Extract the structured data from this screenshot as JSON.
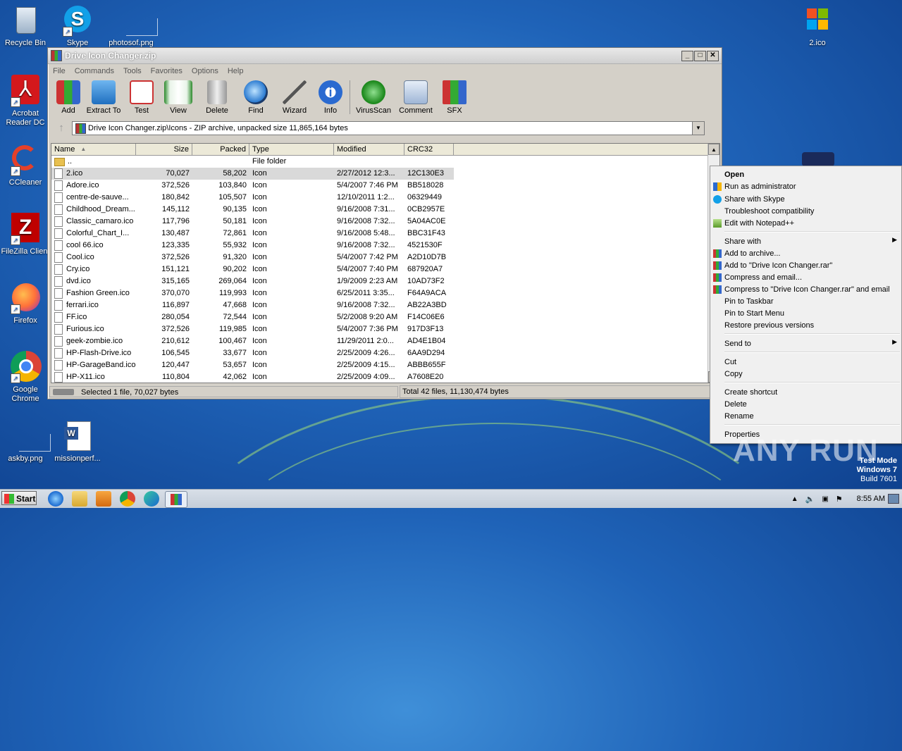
{
  "desktop": {
    "icons": [
      {
        "label": "Recycle Bin",
        "icon": "recycle-bin-icon"
      },
      {
        "label": "Skype",
        "icon": "skype-icon"
      },
      {
        "label": "photosof.png",
        "icon": "image-file-icon"
      },
      {
        "label": "Acrobat Reader DC",
        "icon": "acrobat-icon"
      },
      {
        "label": "CCleaner",
        "icon": "ccleaner-icon"
      },
      {
        "label": "FileZilla Client",
        "icon": "filezilla-icon"
      },
      {
        "label": "Firefox",
        "icon": "firefox-icon"
      },
      {
        "label": "Google Chrome",
        "icon": "chrome-icon"
      },
      {
        "label": "askby.png",
        "icon": "image-file-icon"
      },
      {
        "label": "missionperf...",
        "icon": "word-doc-icon"
      },
      {
        "label": "2.ico",
        "icon": "windows-logo-icon"
      }
    ],
    "testmode": [
      "Test Mode",
      "Windows 7",
      "Build 7601"
    ],
    "watermark": "ANY RUN"
  },
  "window": {
    "title": "Drive Icon Changer.zip",
    "menu": [
      "File",
      "Commands",
      "Tools",
      "Favorites",
      "Options",
      "Help"
    ],
    "toolbar": [
      {
        "label": "Add",
        "icon": "add-archive-icon"
      },
      {
        "label": "Extract To",
        "icon": "extract-folder-icon"
      },
      {
        "label": "Test",
        "icon": "test-checklist-icon"
      },
      {
        "label": "View",
        "icon": "view-book-icon"
      },
      {
        "label": "Delete",
        "icon": "trash-icon"
      },
      {
        "label": "Find",
        "icon": "magnifier-icon"
      },
      {
        "label": "Wizard",
        "icon": "wand-icon"
      },
      {
        "label": "Info",
        "icon": "info-icon"
      },
      {
        "label": "VirusScan",
        "icon": "virus-scan-icon"
      },
      {
        "label": "Comment",
        "icon": "comment-icon"
      },
      {
        "label": "SFX",
        "icon": "sfx-box-icon"
      }
    ],
    "address": "Drive Icon Changer.zip\\Icons - ZIP archive, unpacked size 11,865,164 bytes",
    "columns": [
      "Name",
      "Size",
      "Packed",
      "Type",
      "Modified",
      "CRC32"
    ],
    "files": [
      {
        "name": "..",
        "size": "",
        "packed": "",
        "type": "File folder",
        "modified": "",
        "crc": ""
      },
      {
        "name": "2.ico",
        "size": "70,027",
        "packed": "58,202",
        "type": "Icon",
        "modified": "2/27/2012 12:3...",
        "crc": "12C130E3"
      },
      {
        "name": "Adore.ico",
        "size": "372,526",
        "packed": "103,840",
        "type": "Icon",
        "modified": "5/4/2007 7:46 PM",
        "crc": "BB518028"
      },
      {
        "name": "centre-de-sauve...",
        "size": "180,842",
        "packed": "105,507",
        "type": "Icon",
        "modified": "12/10/2011 1:2...",
        "crc": "06329449"
      },
      {
        "name": "Childhood_Dream...",
        "size": "145,112",
        "packed": "90,135",
        "type": "Icon",
        "modified": "9/16/2008 7:31...",
        "crc": "0CB2957E"
      },
      {
        "name": "Classic_camaro.ico",
        "size": "117,796",
        "packed": "50,181",
        "type": "Icon",
        "modified": "9/16/2008 7:32...",
        "crc": "5A04AC0E"
      },
      {
        "name": "Colorful_Chart_I...",
        "size": "130,487",
        "packed": "72,861",
        "type": "Icon",
        "modified": "9/16/2008 5:48...",
        "crc": "BBC31F43"
      },
      {
        "name": "cool 66.ico",
        "size": "123,335",
        "packed": "55,932",
        "type": "Icon",
        "modified": "9/16/2008 7:32...",
        "crc": "4521530F"
      },
      {
        "name": "Cool.ico",
        "size": "372,526",
        "packed": "91,320",
        "type": "Icon",
        "modified": "5/4/2007 7:42 PM",
        "crc": "A2D10D7B"
      },
      {
        "name": "Cry.ico",
        "size": "151,121",
        "packed": "90,202",
        "type": "Icon",
        "modified": "5/4/2007 7:40 PM",
        "crc": "687920A7"
      },
      {
        "name": "dvd.ico",
        "size": "315,165",
        "packed": "269,064",
        "type": "Icon",
        "modified": "1/9/2009 2:23 AM",
        "crc": "10AD73F2"
      },
      {
        "name": "Fashion Green.ico",
        "size": "370,070",
        "packed": "119,993",
        "type": "Icon",
        "modified": "6/25/2011 3:35...",
        "crc": "F64A9ACA"
      },
      {
        "name": "ferrari.ico",
        "size": "116,897",
        "packed": "47,668",
        "type": "Icon",
        "modified": "9/16/2008 7:32...",
        "crc": "AB22A3BD"
      },
      {
        "name": "FF.ico",
        "size": "280,054",
        "packed": "72,544",
        "type": "Icon",
        "modified": "5/2/2008 9:20 AM",
        "crc": "F14C06E6"
      },
      {
        "name": "Furious.ico",
        "size": "372,526",
        "packed": "119,985",
        "type": "Icon",
        "modified": "5/4/2007 7:36 PM",
        "crc": "917D3F13"
      },
      {
        "name": "geek-zombie.ico",
        "size": "210,612",
        "packed": "100,467",
        "type": "Icon",
        "modified": "11/29/2011 2:0...",
        "crc": "AD4E1B04"
      },
      {
        "name": "HP-Flash-Drive.ico",
        "size": "106,545",
        "packed": "33,677",
        "type": "Icon",
        "modified": "2/25/2009 4:26...",
        "crc": "6AA9D294"
      },
      {
        "name": "HP-GarageBand.ico",
        "size": "120,447",
        "packed": "53,657",
        "type": "Icon",
        "modified": "2/25/2009 4:15...",
        "crc": "ABBB655F"
      },
      {
        "name": "HP-X11.ico",
        "size": "110,804",
        "packed": "42,062",
        "type": "Icon",
        "modified": "2/25/2009 4:09...",
        "crc": "A7608E20"
      }
    ],
    "status_left": "Selected 1 file, 70,027 bytes",
    "status_right": "Total 42 files, 11,130,474 bytes"
  },
  "context_menu": {
    "items": [
      {
        "label": "Open",
        "bold": true
      },
      {
        "label": "Run as administrator",
        "icon": "uac-shield-icon"
      },
      {
        "label": "Share with Skype",
        "icon": "skype-icon"
      },
      {
        "label": "Troubleshoot compatibility"
      },
      {
        "label": "Edit with Notepad++",
        "icon": "notepadpp-icon"
      },
      {
        "label": "Share with",
        "submenu": true
      },
      {
        "label": "Add to archive...",
        "icon": "winrar-icon"
      },
      {
        "label": "Add to \"Drive Icon Changer.rar\"",
        "icon": "winrar-icon"
      },
      {
        "label": "Compress and email...",
        "icon": "winrar-icon"
      },
      {
        "label": "Compress to \"Drive Icon Changer.rar\" and email",
        "icon": "winrar-icon"
      },
      {
        "label": "Pin to Taskbar"
      },
      {
        "label": "Pin to Start Menu"
      },
      {
        "label": "Restore previous versions"
      },
      {
        "label": "Send to",
        "submenu": true
      },
      {
        "label": "Cut"
      },
      {
        "label": "Copy"
      },
      {
        "label": "Create shortcut"
      },
      {
        "label": "Delete"
      },
      {
        "label": "Rename"
      },
      {
        "label": "Properties"
      }
    ]
  },
  "taskbar": {
    "start": "Start",
    "apps": [
      "ie-icon",
      "explorer-icon",
      "media-player-icon",
      "chrome-icon",
      "edge-icon",
      "winrar-icon"
    ],
    "clock": "8:55 AM"
  }
}
